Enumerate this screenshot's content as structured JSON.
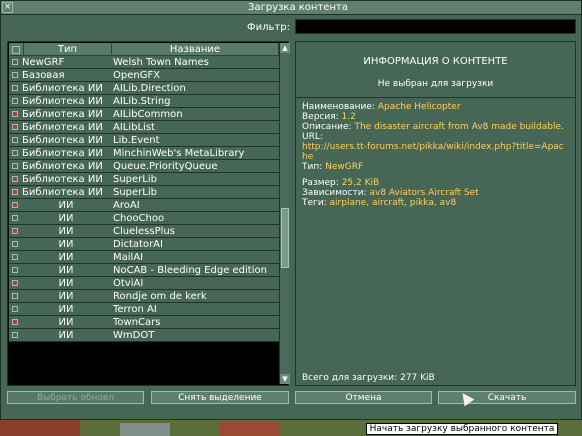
{
  "window": {
    "title": "Загрузка контента"
  },
  "filter": {
    "label": "Фильтр:",
    "value": ""
  },
  "list": {
    "headers": {
      "type": "Тип",
      "name": "Название"
    },
    "rows": [
      {
        "checked": false,
        "type": "NewGRF",
        "name": "Welsh Town Names"
      },
      {
        "checked": false,
        "type": "Базовая графика",
        "name": "OpenGFX"
      },
      {
        "checked": false,
        "type": "Библиотека ИИ",
        "name": "AILib.Direction"
      },
      {
        "checked": false,
        "type": "Библиотека ИИ",
        "name": "AILib.String"
      },
      {
        "checked": true,
        "type": "Библиотека ИИ",
        "name": "AILibCommon"
      },
      {
        "checked": true,
        "type": "Библиотека ИИ",
        "name": "AILibList"
      },
      {
        "checked": false,
        "type": "Библиотека ИИ",
        "name": "Lib.Event"
      },
      {
        "checked": false,
        "type": "Библиотека ИИ",
        "name": "MinchinWeb's MetaLibrary"
      },
      {
        "checked": false,
        "type": "Библиотека ИИ",
        "name": "Queue.PriorityQueue"
      },
      {
        "checked": true,
        "type": "Библиотека ИИ",
        "name": "SuperLib"
      },
      {
        "checked": true,
        "type": "Библиотека ИИ",
        "name": "SuperLib"
      },
      {
        "checked": true,
        "type": "ИИ",
        "name": "AroAI"
      },
      {
        "checked": false,
        "type": "ИИ",
        "name": "ChooChoo"
      },
      {
        "checked": true,
        "type": "ИИ",
        "name": "CluelessPlus"
      },
      {
        "checked": false,
        "type": "ИИ",
        "name": "DictatorAI"
      },
      {
        "checked": false,
        "type": "ИИ",
        "name": "MailAI"
      },
      {
        "checked": false,
        "type": "ИИ",
        "name": "NoCAB - Bleeding Edge edition"
      },
      {
        "checked": true,
        "type": "ИИ",
        "name": "OtviAI"
      },
      {
        "checked": false,
        "type": "ИИ",
        "name": "Rondje om de kerk"
      },
      {
        "checked": false,
        "type": "ИИ",
        "name": "Terron AI"
      },
      {
        "checked": true,
        "type": "ИИ",
        "name": "TownCars"
      },
      {
        "checked": false,
        "type": "ИИ",
        "name": "WmDOT"
      }
    ]
  },
  "info": {
    "title": "ИНФОРМАЦИЯ О КОНТЕНТЕ",
    "status": "Не выбран для загрузки",
    "name_label": "Наименование:",
    "name_value": "Apache Helicopter",
    "version_label": "Версия:",
    "version_value": "1.2",
    "desc_label": "Описание:",
    "desc_value": "The disaster aircraft from Av8 made buildable.",
    "url_label": "URL:",
    "url_value": "http://users.tt-forums.net/pikka/wiki/index.php?title=Apache",
    "type_label": "Тип:",
    "type_value": "NewGRF",
    "size_label": "Размер:",
    "size_value": "25,2 KiB",
    "deps_label": "Зависимости:",
    "deps_value": "av8 Aviators Aircraft Set",
    "tags_label": "Теги:",
    "tags_value": "airplane, aircraft, pikka, av8",
    "total_label": "Всего для загрузки:",
    "total_value": "277 KiB"
  },
  "buttons": {
    "select_updates": "Выбрать обновл",
    "deselect": "Снять выделение",
    "cancel": "Отмена",
    "download": "Скачать"
  },
  "tooltip": "Начать загрузку выбранного контента"
}
